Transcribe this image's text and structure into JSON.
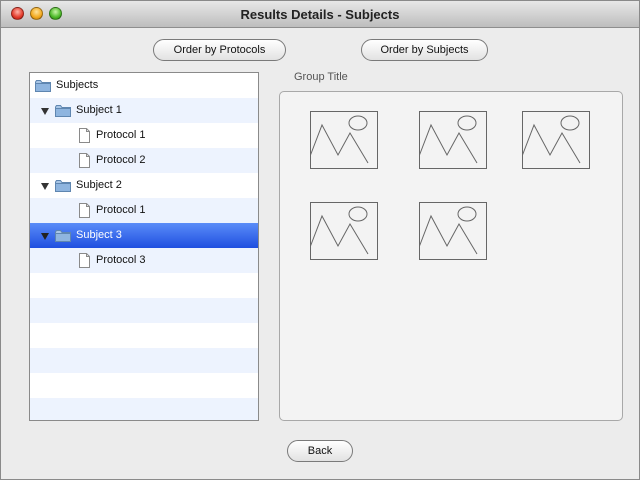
{
  "window": {
    "title": "Results Details - Subjects"
  },
  "toolbar": {
    "order_by_protocols": "Order by Protocols",
    "order_by_subjects": "Order by Subjects"
  },
  "tree": {
    "root_label": "Subjects",
    "items": [
      {
        "label": "Subject 1",
        "type": "folder",
        "expanded": true
      },
      {
        "label": "Protocol 1",
        "type": "file"
      },
      {
        "label": "Protocol 2",
        "type": "file"
      },
      {
        "label": "Subject 2",
        "type": "folder",
        "expanded": true
      },
      {
        "label": "Protocol 1",
        "type": "file"
      },
      {
        "label": "Subject 3",
        "type": "folder",
        "expanded": true,
        "selected": true
      },
      {
        "label": "Protocol 3",
        "type": "file"
      }
    ]
  },
  "group": {
    "title": "Group Title",
    "image_count": 5,
    "image_icon": "image-placeholder-icon"
  },
  "footer": {
    "back_label": "Back"
  },
  "colors": {
    "selection": "#2f60ee",
    "row_alt": "#edf3fe",
    "window_bg": "#ececec"
  }
}
